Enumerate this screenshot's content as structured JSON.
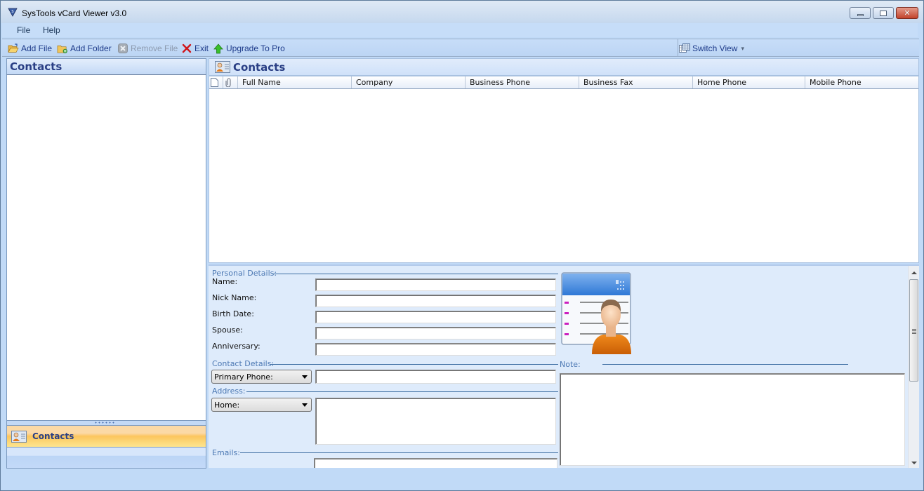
{
  "window": {
    "title": "SysTools vCard Viewer v3.0",
    "controls": {
      "minimize": "minimize",
      "maximize": "maximize",
      "close": "✕"
    }
  },
  "menubar": {
    "items": [
      {
        "label": "File"
      },
      {
        "label": "Help"
      }
    ]
  },
  "toolbar": {
    "add_file": "Add File",
    "add_folder": "Add Folder",
    "remove_file": "Remove File",
    "exit": "Exit",
    "upgrade": "Upgrade To Pro",
    "switch_view": "Switch View",
    "switch_view_arrow": "▾"
  },
  "left_pane": {
    "header": "Contacts",
    "nav_item": "Contacts"
  },
  "right_pane": {
    "header": "Contacts",
    "grid": {
      "columns": [
        "Full Name",
        "Company",
        "Business Phone",
        "Business Fax",
        "Home Phone",
        "Mobile Phone"
      ],
      "rows": []
    }
  },
  "details": {
    "personal": {
      "group_label": "Personal Details:",
      "fields": [
        {
          "label": "Name:",
          "value": ""
        },
        {
          "label": "Nick Name:",
          "value": ""
        },
        {
          "label": "Birth Date:",
          "value": ""
        },
        {
          "label": "Spouse:",
          "value": ""
        },
        {
          "label": "Anniversary:",
          "value": ""
        }
      ]
    },
    "contact": {
      "group_label": "Contact Details:",
      "phone_type": "Primary Phone:",
      "phone_value": ""
    },
    "address": {
      "group_label": "Address:",
      "type": "Home:",
      "value": ""
    },
    "emails": {
      "group_label": "Emails:",
      "value": ""
    },
    "note": {
      "group_label": "Note:",
      "value": ""
    }
  },
  "colors": {
    "accent_blue": "#2a3f85",
    "toolbar_text": "#1e3b8a",
    "group_label": "#4c78b3",
    "nav_selected": "#fcc65e",
    "exit_red": "#d0151a",
    "upgrade_green": "#2fae1f"
  }
}
